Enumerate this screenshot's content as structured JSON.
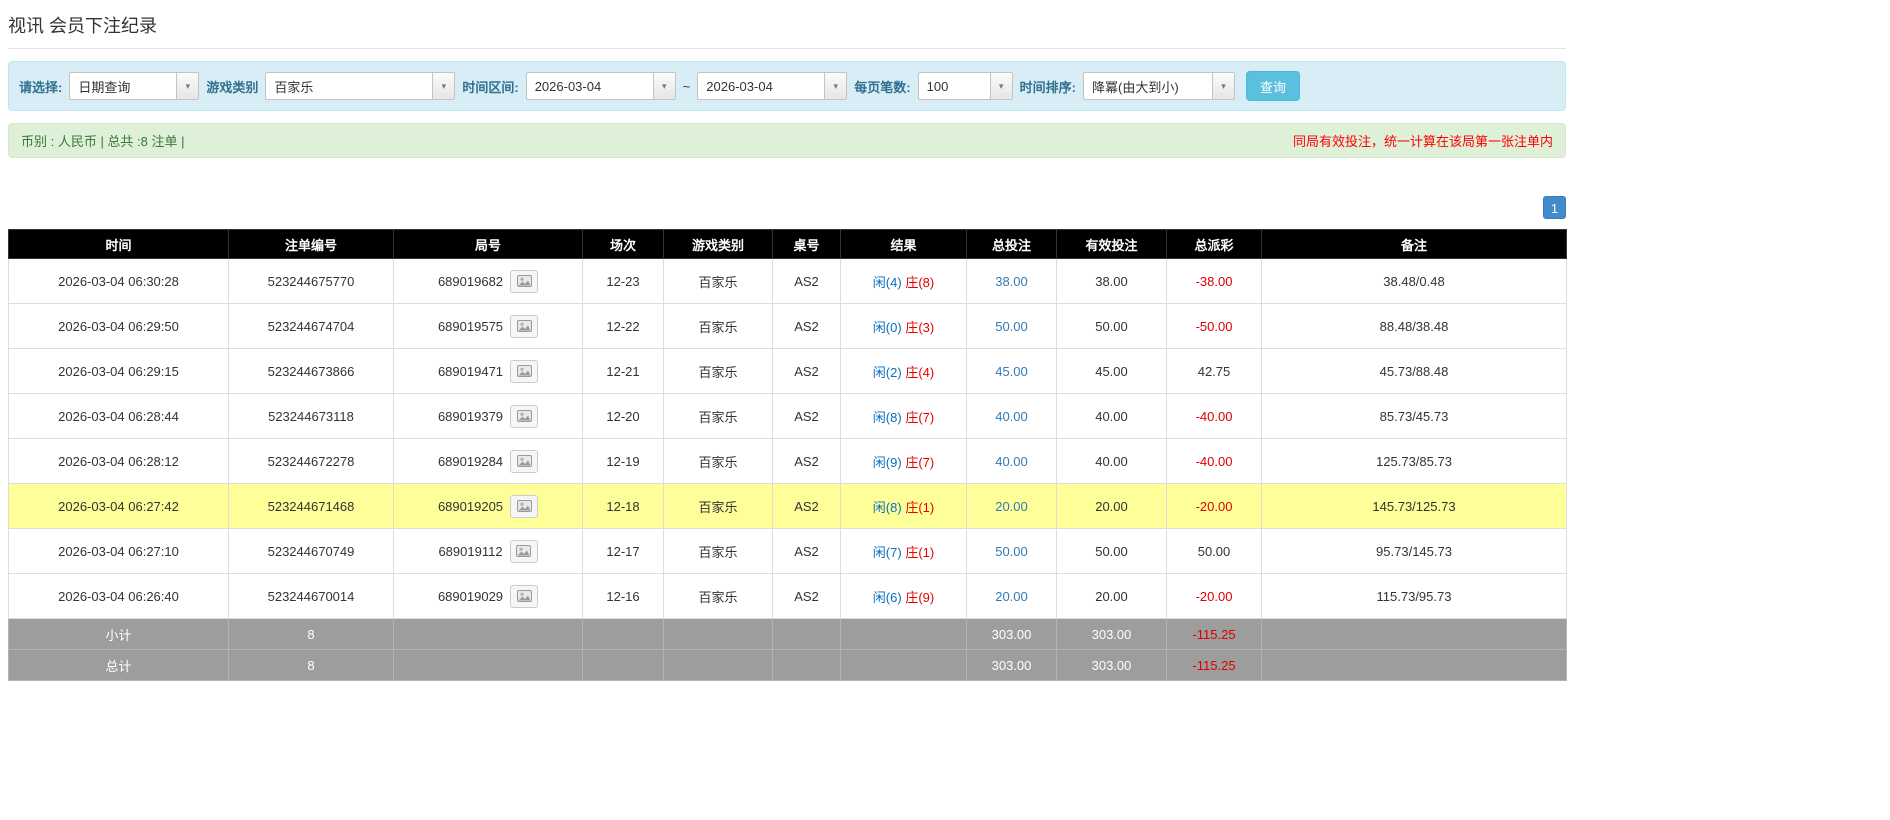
{
  "page": {
    "title": "视讯 会员下注纪录"
  },
  "filters": {
    "select_label": "请选择:",
    "select_value": "日期查询",
    "game_type_label": "游戏类别",
    "game_type_value": "百家乐",
    "time_range_label": "时间区间:",
    "date_from": "2026-03-04",
    "date_to": "2026-03-04",
    "range_separator": "~",
    "page_size_label": "每页笔数:",
    "page_size_value": "100",
    "sort_label": "时间排序:",
    "sort_value": "降冪(由大到小)",
    "search_button": "查询"
  },
  "summary": {
    "left_text": "币别 : 人民币 | 总共 :8 注单 |",
    "right_notice": "同局有效投注，统一计算在该局第一张注单内"
  },
  "pagination": {
    "current_page": "1"
  },
  "table": {
    "headers": [
      "时间",
      "注单编号",
      "局号",
      "场次",
      "游戏类别",
      "桌号",
      "结果",
      "总投注",
      "有效投注",
      "总派彩",
      "备注"
    ],
    "rows": [
      {
        "time": "2026-03-04 06:30:28",
        "bet_id": "523244675770",
        "round_id": "689019682",
        "session": "12-23",
        "game": "百家乐",
        "table_no": "AS2",
        "result_player": "闲(4)",
        "result_banker": "庄(8)",
        "total_bet": "38.00",
        "valid_bet": "38.00",
        "payout": "-38.00",
        "remark": "38.48/0.48",
        "highlighted": false
      },
      {
        "time": "2026-03-04 06:29:50",
        "bet_id": "523244674704",
        "round_id": "689019575",
        "session": "12-22",
        "game": "百家乐",
        "table_no": "AS2",
        "result_player": "闲(0)",
        "result_banker": "庄(3)",
        "total_bet": "50.00",
        "valid_bet": "50.00",
        "payout": "-50.00",
        "remark": "88.48/38.48",
        "highlighted": false
      },
      {
        "time": "2026-03-04 06:29:15",
        "bet_id": "523244673866",
        "round_id": "689019471",
        "session": "12-21",
        "game": "百家乐",
        "table_no": "AS2",
        "result_player": "闲(2)",
        "result_banker": "庄(4)",
        "total_bet": "45.00",
        "valid_bet": "45.00",
        "payout": "42.75",
        "remark": "45.73/88.48",
        "highlighted": false
      },
      {
        "time": "2026-03-04 06:28:44",
        "bet_id": "523244673118",
        "round_id": "689019379",
        "session": "12-20",
        "game": "百家乐",
        "table_no": "AS2",
        "result_player": "闲(8)",
        "result_banker": "庄(7)",
        "total_bet": "40.00",
        "valid_bet": "40.00",
        "payout": "-40.00",
        "remark": "85.73/45.73",
        "highlighted": false
      },
      {
        "time": "2026-03-04 06:28:12",
        "bet_id": "523244672278",
        "round_id": "689019284",
        "session": "12-19",
        "game": "百家乐",
        "table_no": "AS2",
        "result_player": "闲(9)",
        "result_banker": "庄(7)",
        "total_bet": "40.00",
        "valid_bet": "40.00",
        "payout": "-40.00",
        "remark": "125.73/85.73",
        "highlighted": false
      },
      {
        "time": "2026-03-04 06:27:42",
        "bet_id": "523244671468",
        "round_id": "689019205",
        "session": "12-18",
        "game": "百家乐",
        "table_no": "AS2",
        "result_player": "闲(8)",
        "result_banker": "庄(1)",
        "total_bet": "20.00",
        "valid_bet": "20.00",
        "payout": "-20.00",
        "remark": "145.73/125.73",
        "highlighted": true
      },
      {
        "time": "2026-03-04 06:27:10",
        "bet_id": "523244670749",
        "round_id": "689019112",
        "session": "12-17",
        "game": "百家乐",
        "table_no": "AS2",
        "result_player": "闲(7)",
        "result_banker": "庄(1)",
        "total_bet": "50.00",
        "valid_bet": "50.00",
        "payout": "50.00",
        "remark": "95.73/145.73",
        "highlighted": false
      },
      {
        "time": "2026-03-04 06:26:40",
        "bet_id": "523244670014",
        "round_id": "689019029",
        "session": "12-16",
        "game": "百家乐",
        "table_no": "AS2",
        "result_player": "闲(6)",
        "result_banker": "庄(9)",
        "total_bet": "20.00",
        "valid_bet": "20.00",
        "payout": "-20.00",
        "remark": "115.73/95.73",
        "highlighted": false
      }
    ],
    "footer": [
      {
        "label": "小计",
        "count": "8",
        "total_bet": "303.00",
        "valid_bet": "303.00",
        "payout": "-115.25"
      },
      {
        "label": "总计",
        "count": "8",
        "total_bet": "303.00",
        "valid_bet": "303.00",
        "payout": "-115.25"
      }
    ]
  },
  "colors": {
    "accent_blue": "#428bca",
    "search_button": "#5bc0de",
    "filter_bar_bg": "#d9edf7",
    "summary_bar_bg": "#dff0d8",
    "highlight_row": "#ffff99",
    "negative_red": "#dd0000",
    "player_blue": "#0a6ebd",
    "banker_red": "#e60000"
  }
}
